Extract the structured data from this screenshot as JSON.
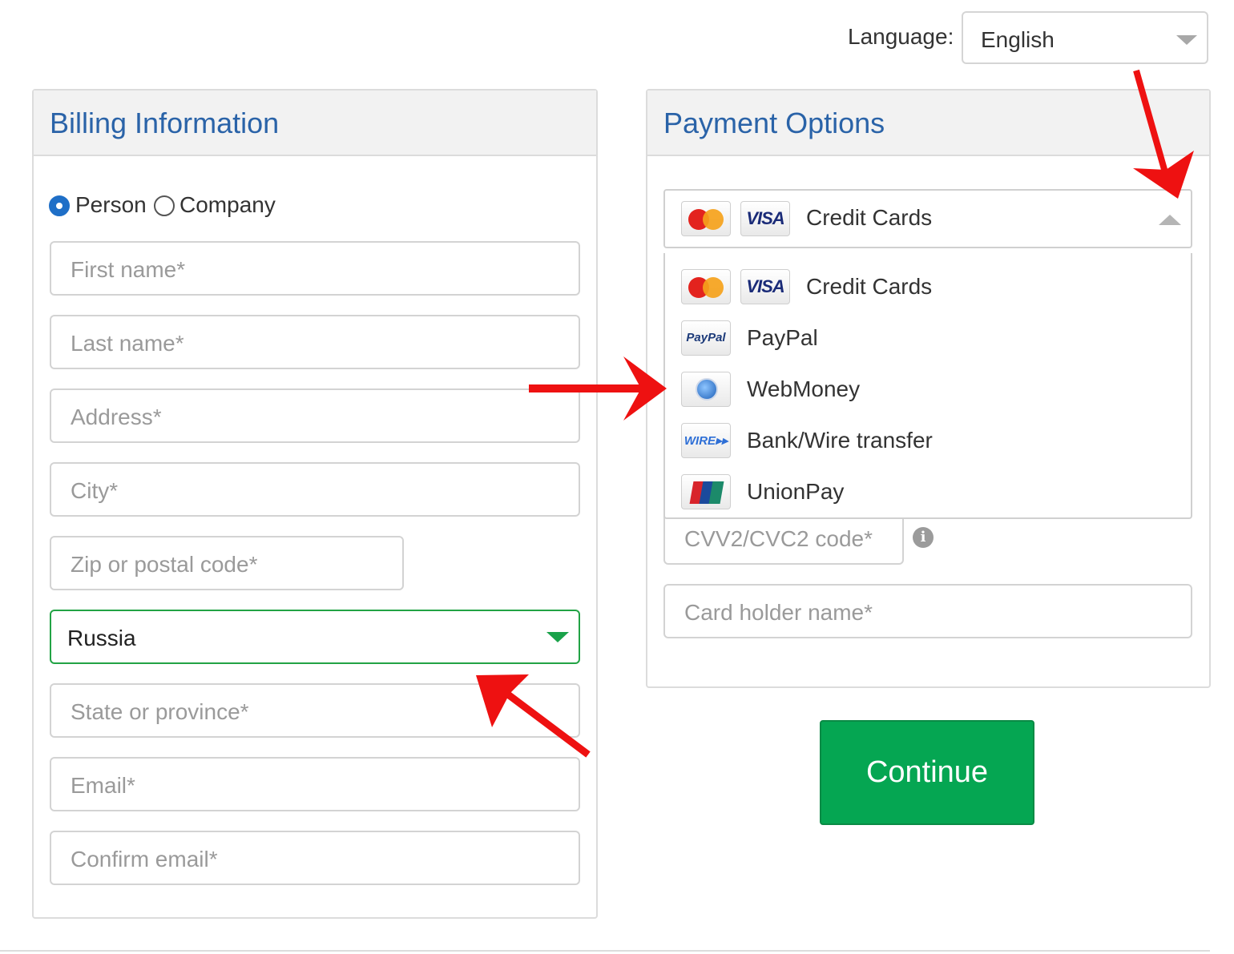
{
  "language": {
    "label": "Language:",
    "selected": "English"
  },
  "billing": {
    "title": "Billing Information",
    "type_options": [
      {
        "label": "Person",
        "selected": true
      },
      {
        "label": "Company",
        "selected": false
      }
    ],
    "fields": {
      "first_name": "First name*",
      "last_name": "Last name*",
      "address": "Address*",
      "city": "City*",
      "zip": "Zip or postal code*",
      "state": "State or province*",
      "email": "Email*",
      "confirm_email": "Confirm email*"
    },
    "country": "Russia"
  },
  "payment": {
    "title": "Payment Options",
    "selected": {
      "label": "Credit Cards",
      "icons": [
        "mastercard-icon",
        "visa-icon"
      ]
    },
    "options": [
      {
        "label": "Credit Cards",
        "icons": [
          "mastercard-icon",
          "visa-icon"
        ]
      },
      {
        "label": "PayPal",
        "icons": [
          "paypal-icon"
        ]
      },
      {
        "label": "WebMoney",
        "icons": [
          "webmoney-icon"
        ]
      },
      {
        "label": "Bank/Wire transfer",
        "icons": [
          "wire-icon"
        ]
      },
      {
        "label": "UnionPay",
        "icons": [
          "unionpay-icon"
        ]
      }
    ],
    "fields": {
      "cvv": "CVV2/CVC2 code*",
      "card_holder": "Card holder name*"
    },
    "info_icon": "i"
  },
  "continue_label": "Continue",
  "colors": {
    "title_blue": "#2a63a8",
    "accent_green": "#05a652",
    "radio_blue": "#1f6fc7",
    "annotation_red": "#ee1111"
  }
}
